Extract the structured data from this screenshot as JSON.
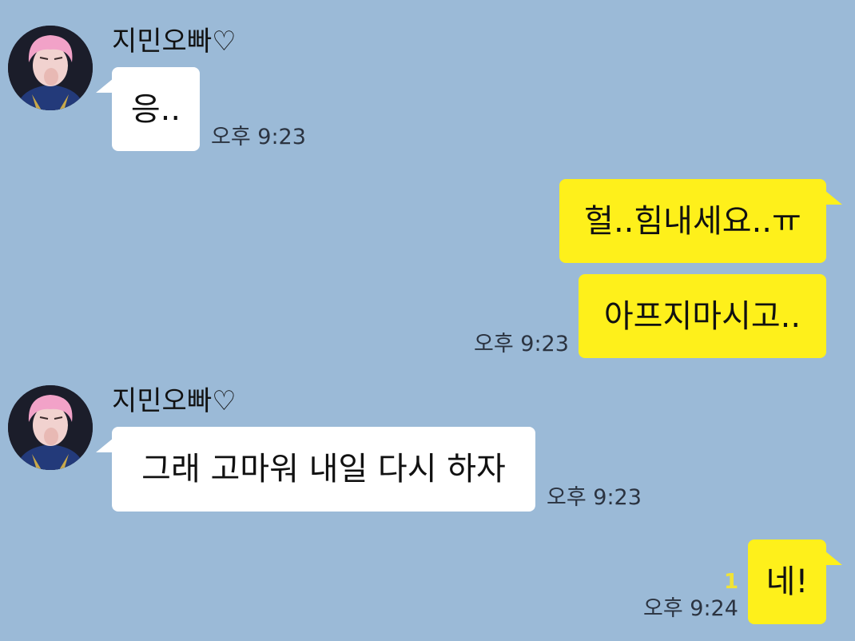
{
  "chat": {
    "colors": {
      "background": "#9bbad7",
      "incoming_bubble": "#ffffff",
      "outgoing_bubble": "#fef01b",
      "unread_count": "#f0e336"
    },
    "messages": [
      {
        "sender": "지민오빠♡",
        "avatar": "profile-photo-pink-hair",
        "text": "응..",
        "time": "오후 9:23"
      },
      {
        "text": "헐..힘내세요..ㅠ"
      },
      {
        "text": "아프지마시고..",
        "time": "오후 9:23"
      },
      {
        "sender": "지민오빠♡",
        "avatar": "profile-photo-pink-hair",
        "text": "그래 고마워 내일 다시 하자",
        "time": "오후 9:23"
      },
      {
        "text": "네!",
        "unread": "1",
        "time": "오후 9:24"
      }
    ]
  }
}
